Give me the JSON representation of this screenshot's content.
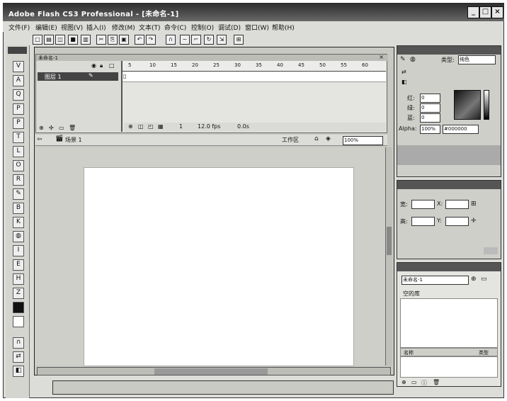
{
  "window": {
    "title": "Adobe Flash CS3 Professional - [未命名-1]",
    "controls": {
      "minimize": "_",
      "maximize": "□",
      "close": "×"
    }
  },
  "menu": [
    "文件(F)",
    "编辑(E)",
    "视图(V)",
    "插入(I)",
    "修改(M)",
    "文本(T)",
    "命令(C)",
    "控制(O)",
    "调试(D)",
    "窗口(W)",
    "帮助(H)"
  ],
  "document": {
    "tab": "未命名-1",
    "frame_ruler": [
      "5",
      "10",
      "15",
      "20",
      "25",
      "30",
      "35",
      "40",
      "45",
      "50",
      "55",
      "60"
    ],
    "layer_name": "图层 1",
    "timeline_status": {
      "frame": "1",
      "fps": "12.0 fps",
      "time": "0.0s"
    },
    "scene": "场景 1",
    "edit_symbols": "工作区",
    "zoom": "100%"
  },
  "color_panel": {
    "type_label": "类型:",
    "type_value": "纯色",
    "r_label": "红:",
    "r_value": "0",
    "g_label": "绿:",
    "g_value": "0",
    "b_label": "蓝:",
    "b_value": "0",
    "alpha_label": "Alpha:",
    "alpha_value": "100%",
    "hex_value": "#000000"
  },
  "info_panel": {
    "w_label": "宽:",
    "h_label": "高:",
    "x_label": "X:",
    "y_label": "Y:"
  },
  "library_panel": {
    "doc": "未命名-1",
    "empty_label": "空的库",
    "name_col": "名称",
    "type_col": "类型"
  },
  "tools": [
    "V",
    "A",
    "Q",
    "P",
    "T",
    "L",
    "O",
    "R",
    "B",
    "K",
    "I",
    "E",
    "H",
    "Z"
  ]
}
